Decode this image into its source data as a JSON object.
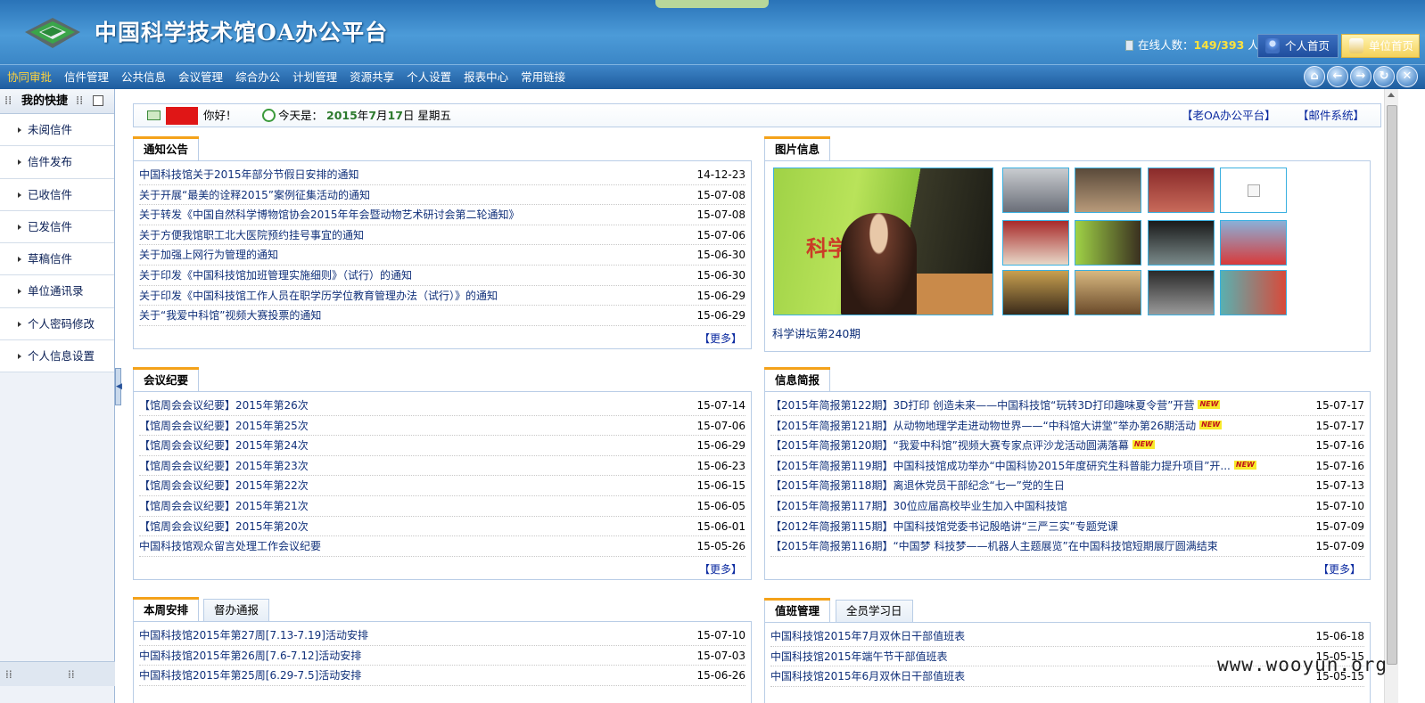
{
  "header": {
    "title": "中国科学技术馆OA办公平台",
    "online_label": "在线人数：",
    "online_count": "149/393",
    "online_unit": "人",
    "personal_home": "个人首页",
    "unit_home": "单位首页"
  },
  "menu": [
    "协同审批",
    "信件管理",
    "公共信息",
    "会议管理",
    "综合办公",
    "计划管理",
    "资源共享",
    "个人设置",
    "报表中心",
    "常用链接"
  ],
  "nav_icons": [
    "home-icon",
    "back-icon",
    "forward-icon",
    "refresh-icon",
    "close-icon"
  ],
  "sidebar": {
    "title": "我的快捷",
    "items": [
      "未阅信件",
      "信件发布",
      "已收信件",
      "已发信件",
      "草稿信件",
      "单位通讯录",
      "个人密码修改",
      "个人信息设置"
    ]
  },
  "greeting": {
    "hello": "你好！",
    "today_label": "今天是：",
    "year": "2015",
    "year_unit": "年",
    "month": "7",
    "month_unit": "月",
    "day": "17",
    "day_unit": "日 星期五",
    "link_old": "【老OA办公平台】",
    "link_mail": "【邮件系统】"
  },
  "notice": {
    "tab": "通知公告",
    "more": "【更多】",
    "rows": [
      {
        "t": "中国科技馆关于2015年部分节假日安排的通知",
        "d": "14-12-23"
      },
      {
        "t": "关于开展“最美的诠释2015”案例征集活动的通知",
        "d": "15-07-08"
      },
      {
        "t": "关于转发《中国自然科学博物馆协会2015年年会暨动物艺术研讨会第二轮通知》",
        "d": "15-07-08"
      },
      {
        "t": "关于方便我馆职工北大医院预约挂号事宜的通知",
        "d": "15-07-06"
      },
      {
        "t": "关于加强上网行为管理的通知",
        "d": "15-06-30"
      },
      {
        "t": "关于印发《中国科技馆加班管理实施细则》（试行）的通知",
        "d": "15-06-30"
      },
      {
        "t": "关于印发《中国科技馆工作人员在职学历学位教育管理办法（试行）》的通知",
        "d": "15-06-29"
      },
      {
        "t": "关于“我爱中科馆”视频大赛投票的通知",
        "d": "15-06-29"
      }
    ]
  },
  "photos": {
    "tab": "图片信息",
    "caption": "科学讲坛第240期"
  },
  "meeting": {
    "tab": "会议纪要",
    "more": "【更多】",
    "rows": [
      {
        "t": "【馆周会会议纪要】2015年第26次",
        "d": "15-07-14"
      },
      {
        "t": "【馆周会会议纪要】2015年第25次",
        "d": "15-07-06"
      },
      {
        "t": "【馆周会会议纪要】2015年第24次",
        "d": "15-06-29"
      },
      {
        "t": "【馆周会会议纪要】2015年第23次",
        "d": "15-06-23"
      },
      {
        "t": "【馆周会会议纪要】2015年第22次",
        "d": "15-06-15"
      },
      {
        "t": "【馆周会会议纪要】2015年第21次",
        "d": "15-06-05"
      },
      {
        "t": "【馆周会会议纪要】2015年第20次",
        "d": "15-06-01"
      },
      {
        "t": "中国科技馆观众留言处理工作会议纪要",
        "d": "15-05-26"
      }
    ]
  },
  "brief": {
    "tab": "信息简报",
    "more": "【更多】",
    "new_label": "NEW",
    "rows": [
      {
        "t": "【2015年简报第122期】3D打印 创造未来——中国科技馆“玩转3D打印趣味夏令营”开营",
        "d": "15-07-17",
        "n": true
      },
      {
        "t": "【2015年简报第121期】从动物地理学走进动物世界——“中科馆大讲堂”举办第26期活动",
        "d": "15-07-17",
        "n": true
      },
      {
        "t": "【2015年简报第120期】“我爱中科馆”视频大赛专家点评沙龙活动圆满落幕",
        "d": "15-07-16",
        "n": true
      },
      {
        "t": "【2015年简报第119期】中国科技馆成功举办“中国科协2015年度研究生科普能力提升项目”开...",
        "d": "15-07-16",
        "n": true
      },
      {
        "t": "【2015年简报第118期】离退休党员干部纪念“七一”党的生日",
        "d": "15-07-13",
        "n": false
      },
      {
        "t": "【2015年简报第117期】30位应届高校毕业生加入中国科技馆",
        "d": "15-07-10",
        "n": false
      },
      {
        "t": "【2012年简报第115期】中国科技馆党委书记殷皓讲“三严三实”专题党课",
        "d": "15-07-09",
        "n": false
      },
      {
        "t": "【2015年简报第116期】“中国梦 科技梦——机器人主题展览”在中国科技馆短期展厅圆满结束",
        "d": "15-07-09",
        "n": false
      }
    ]
  },
  "schedule": {
    "tab_active": "本周安排",
    "tab_other": "督办通报",
    "rows": [
      {
        "t": "中国科技馆2015年第27周[7.13-7.19]活动安排",
        "d": "15-07-10"
      },
      {
        "t": "中国科技馆2015年第26周[7.6-7.12]活动安排",
        "d": "15-07-03"
      },
      {
        "t": "中国科技馆2015年第25周[6.29-7.5]活动安排",
        "d": "15-06-26"
      }
    ]
  },
  "duty": {
    "tab_active": "值班管理",
    "tab_other": "全员学习日",
    "rows": [
      {
        "t": "中国科技馆2015年7月双休日干部值班表",
        "d": "15-06-18"
      },
      {
        "t": "中国科技馆2015年端午节干部值班表",
        "d": "15-05-15"
      },
      {
        "t": "中国科技馆2015年6月双休日干部值班表",
        "d": "15-05-15"
      }
    ]
  },
  "watermark": "www.wooyun.org"
}
